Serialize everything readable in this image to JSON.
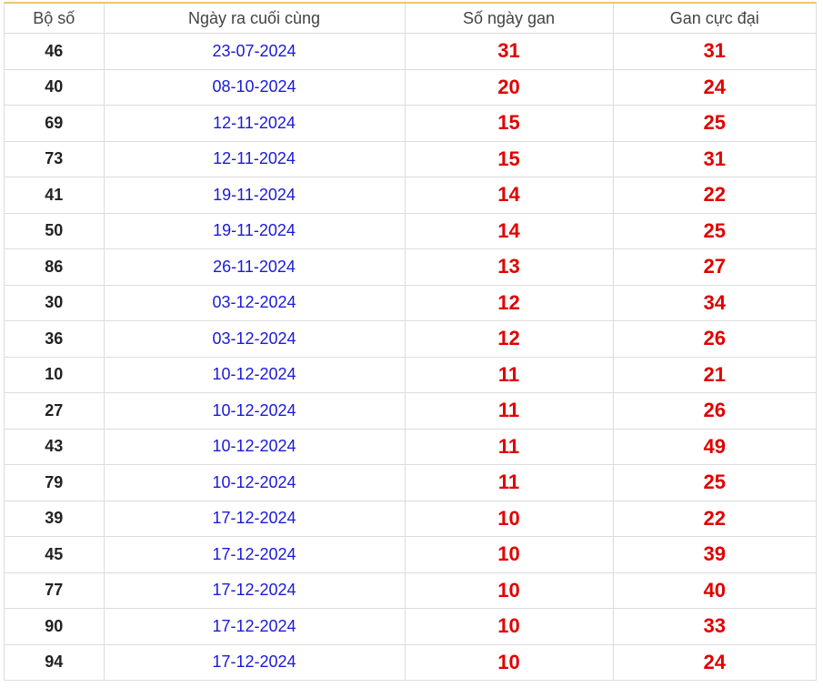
{
  "table": {
    "headers": [
      "Bộ số",
      "Ngày ra cuối cùng",
      "Số ngày gan",
      "Gan cực đại"
    ],
    "rows": [
      {
        "number": "46",
        "last_date": "23-07-2024",
        "days_gan": "31",
        "max_gan": "31"
      },
      {
        "number": "40",
        "last_date": "08-10-2024",
        "days_gan": "20",
        "max_gan": "24"
      },
      {
        "number": "69",
        "last_date": "12-11-2024",
        "days_gan": "15",
        "max_gan": "25"
      },
      {
        "number": "73",
        "last_date": "12-11-2024",
        "days_gan": "15",
        "max_gan": "31"
      },
      {
        "number": "41",
        "last_date": "19-11-2024",
        "days_gan": "14",
        "max_gan": "22"
      },
      {
        "number": "50",
        "last_date": "19-11-2024",
        "days_gan": "14",
        "max_gan": "25"
      },
      {
        "number": "86",
        "last_date": "26-11-2024",
        "days_gan": "13",
        "max_gan": "27"
      },
      {
        "number": "30",
        "last_date": "03-12-2024",
        "days_gan": "12",
        "max_gan": "34"
      },
      {
        "number": "36",
        "last_date": "03-12-2024",
        "days_gan": "12",
        "max_gan": "26"
      },
      {
        "number": "10",
        "last_date": "10-12-2024",
        "days_gan": "11",
        "max_gan": "21"
      },
      {
        "number": "27",
        "last_date": "10-12-2024",
        "days_gan": "11",
        "max_gan": "26"
      },
      {
        "number": "43",
        "last_date": "10-12-2024",
        "days_gan": "11",
        "max_gan": "49"
      },
      {
        "number": "79",
        "last_date": "10-12-2024",
        "days_gan": "11",
        "max_gan": "25"
      },
      {
        "number": "39",
        "last_date": "17-12-2024",
        "days_gan": "10",
        "max_gan": "22"
      },
      {
        "number": "45",
        "last_date": "17-12-2024",
        "days_gan": "10",
        "max_gan": "39"
      },
      {
        "number": "77",
        "last_date": "17-12-2024",
        "days_gan": "10",
        "max_gan": "40"
      },
      {
        "number": "90",
        "last_date": "17-12-2024",
        "days_gan": "10",
        "max_gan": "33"
      },
      {
        "number": "94",
        "last_date": "17-12-2024",
        "days_gan": "10",
        "max_gan": "24"
      }
    ]
  },
  "colors": {
    "header_accent": "#f0c36b",
    "date_text": "#1a1ad6",
    "gan_text": "#e00000",
    "number_text": "#222222",
    "grid": "#dcdcdc"
  }
}
